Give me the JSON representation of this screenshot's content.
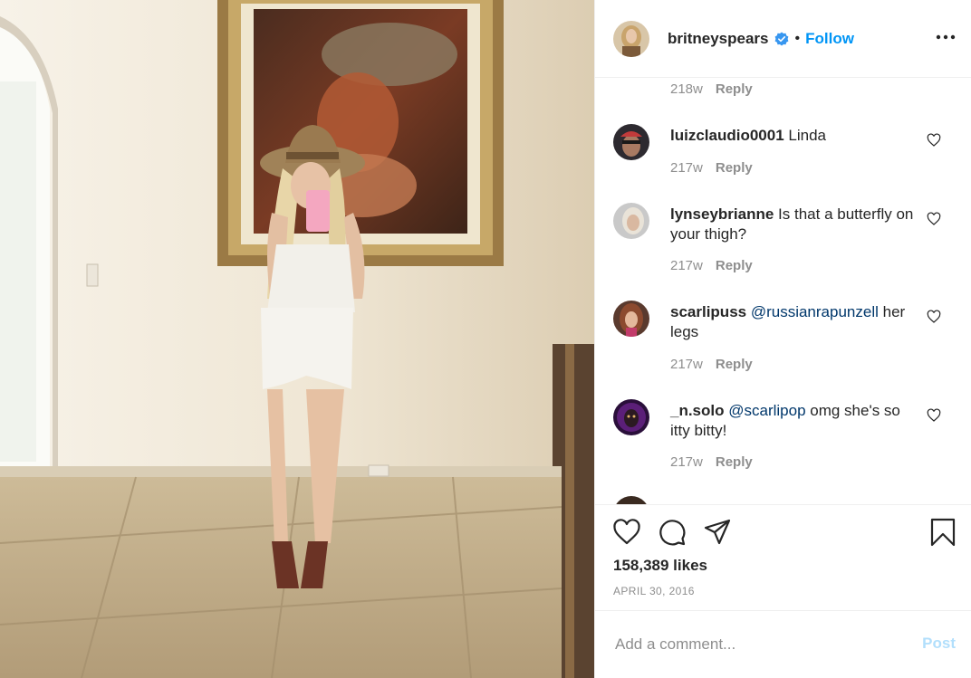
{
  "header": {
    "username": "britneyspears",
    "separator": "•",
    "follow_label": "Follow"
  },
  "first_comment_meta": {
    "ago": "218w",
    "reply": "Reply"
  },
  "comments": [
    {
      "username": "luizclaudio0001",
      "text": " Linda",
      "ago": "217w",
      "reply": "Reply"
    },
    {
      "username": "lynseybrianne",
      "text": " Is that a butterfly on your thigh?",
      "ago": "217w",
      "reply": "Reply"
    },
    {
      "username": "scarlipuss",
      "mention": " @russianrapunzell",
      "text": " her legs",
      "ago": "217w",
      "reply": "Reply"
    },
    {
      "username": "_n.solo",
      "mention": " @scarlipop",
      "text": " omg she's so itty bitty!",
      "ago": "217w",
      "reply": "Reply"
    }
  ],
  "likes": "158,389 likes",
  "date": "APRIL 30, 2016",
  "add_comment": {
    "placeholder": "Add a comment...",
    "post_label": "Post"
  },
  "colors": {
    "follow": "#0095f6",
    "post_disabled": "#b2dffc",
    "muted": "#8e8e8e",
    "mention": "#00376b"
  },
  "icons": [
    "verified-badge-icon",
    "more-options-icon",
    "heart-icon",
    "comment-icon",
    "share-icon",
    "bookmark-icon"
  ]
}
